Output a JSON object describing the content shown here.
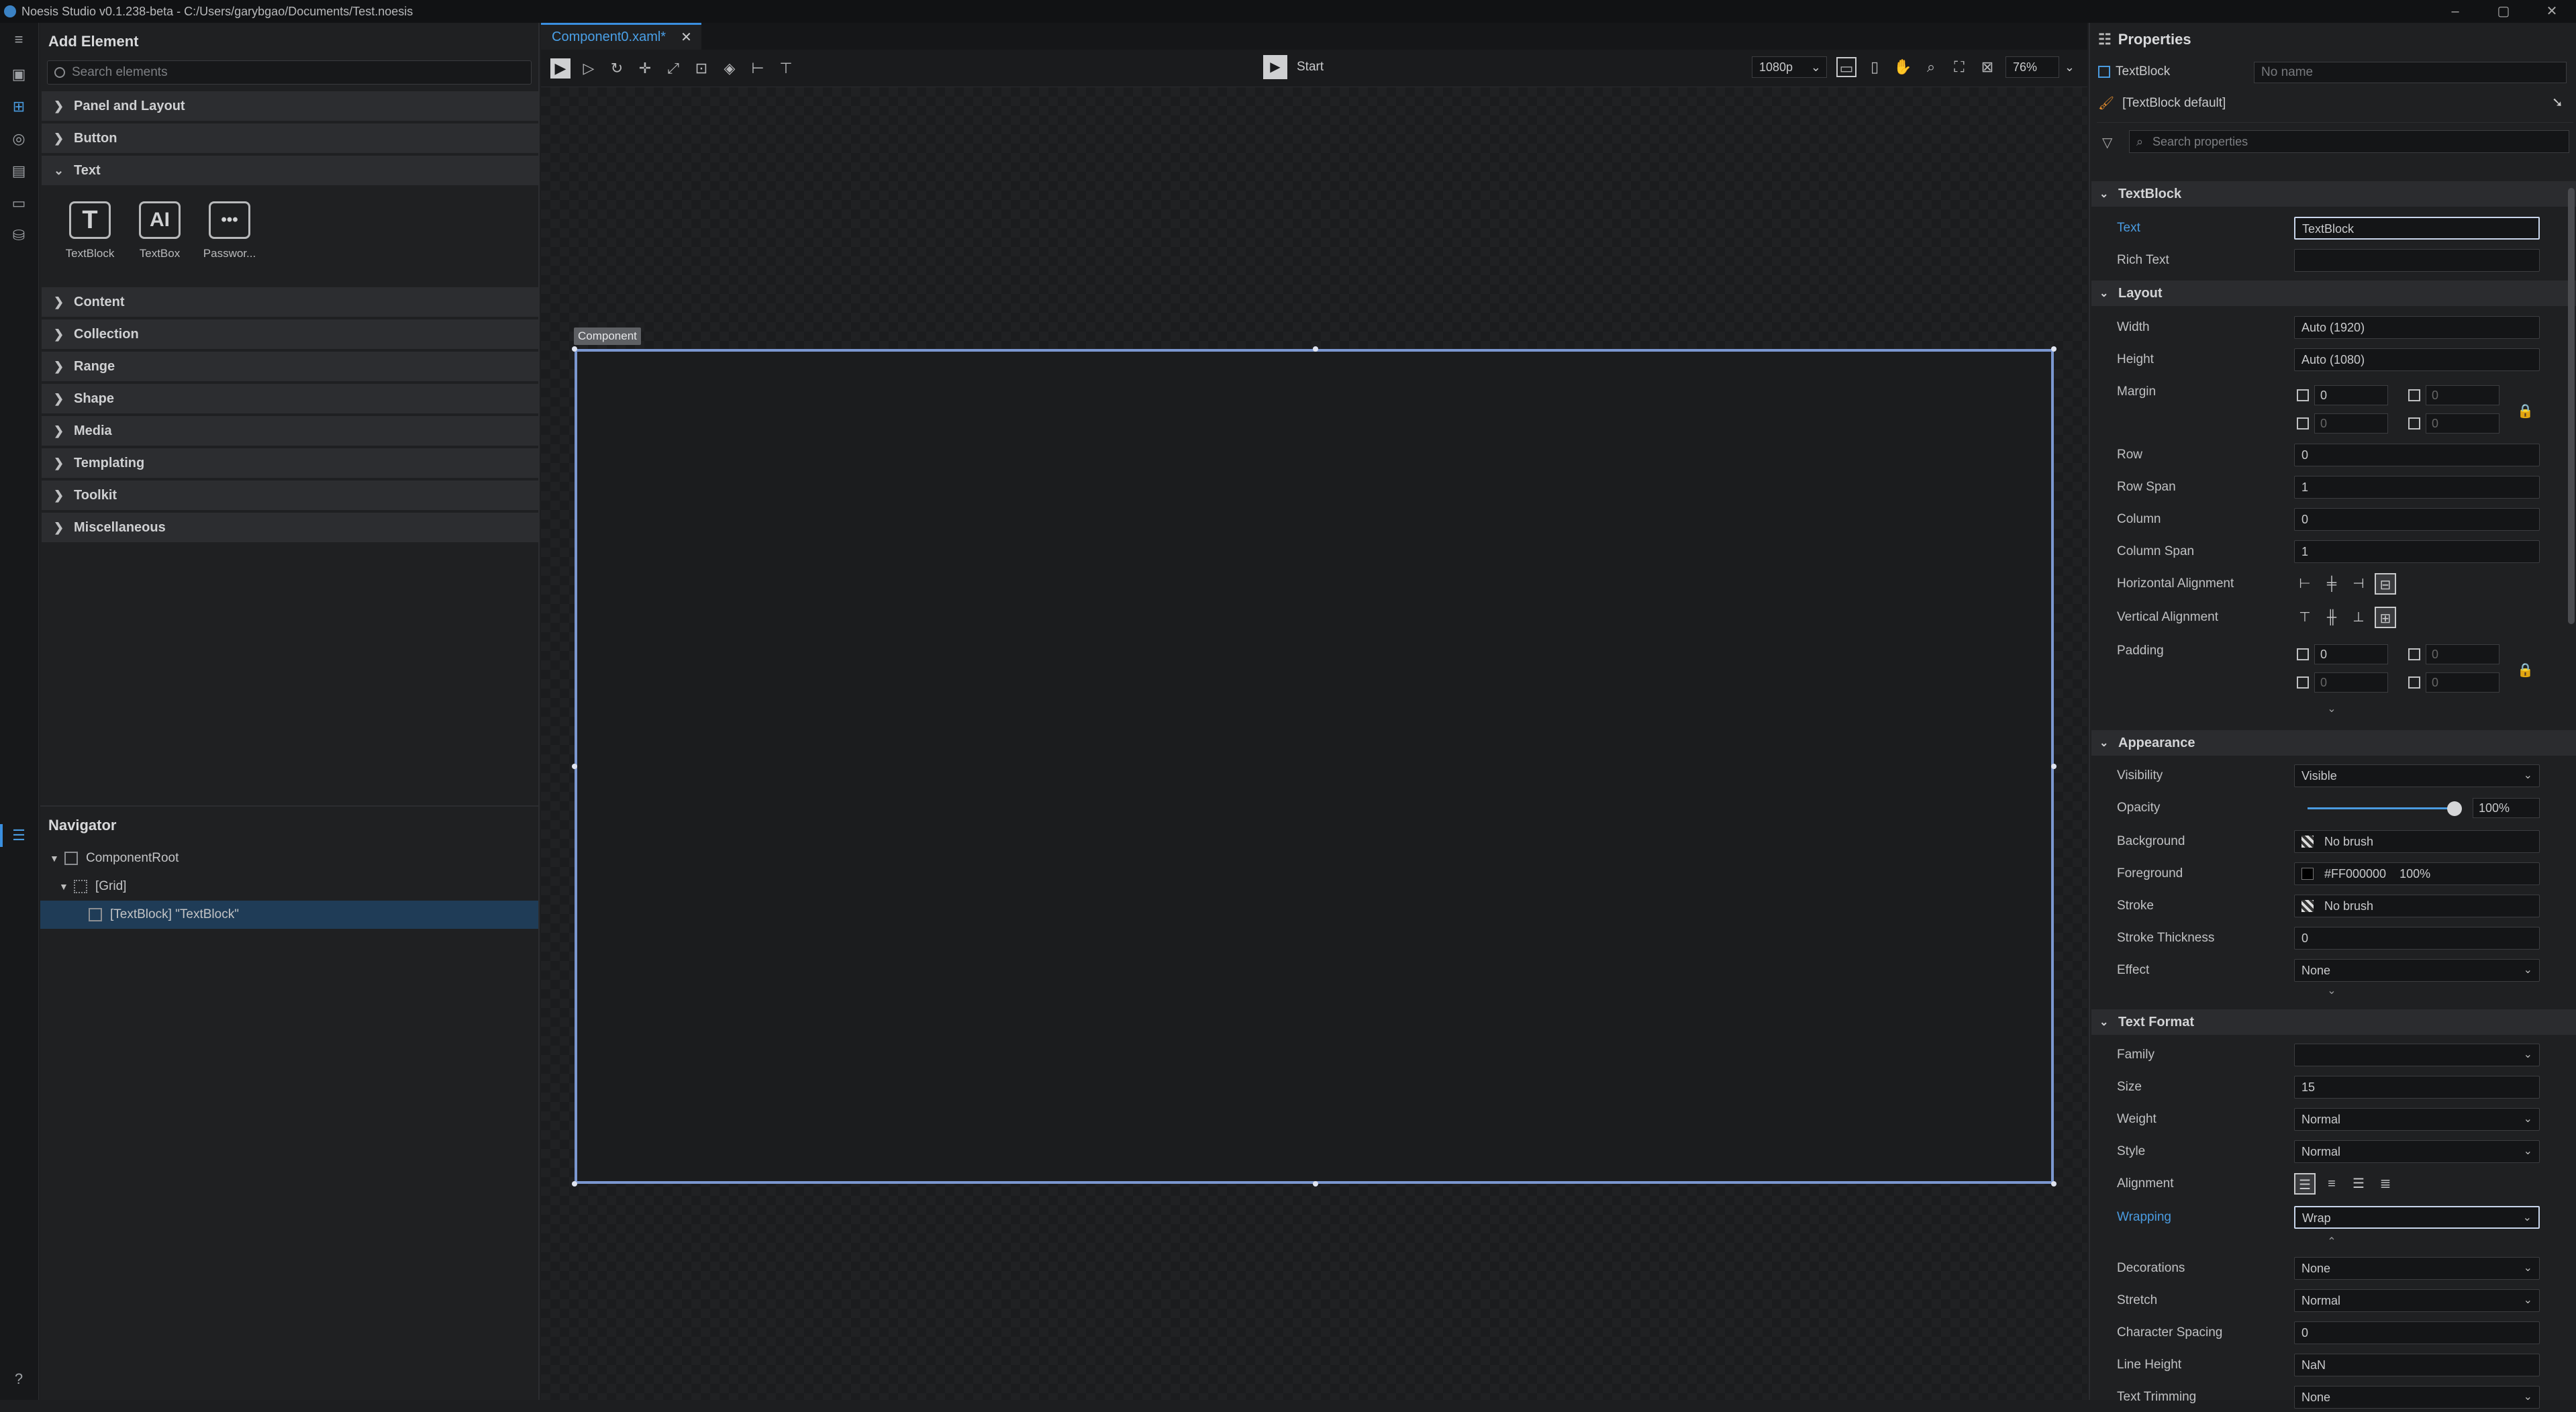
{
  "titlebar": {
    "title": "Noesis Studio v0.1.238-beta - C:/Users/garybgao/Documents/Test.noesis",
    "min": "–",
    "max": "▢",
    "close": "✕"
  },
  "add": {
    "title": "Add Element",
    "search": "Search elements",
    "cats_top": [
      "Panel and Layout",
      "Button",
      "Text"
    ],
    "tiles": [
      {
        "label": "TextBlock",
        "glyph": "T"
      },
      {
        "label": "TextBox",
        "glyph": "AI"
      },
      {
        "label": "Passwor...",
        "glyph": "•••"
      }
    ],
    "cats_bottom": [
      "Content",
      "Collection",
      "Range",
      "Shape",
      "Media",
      "Templating",
      "Toolkit",
      "Miscellaneous"
    ]
  },
  "navigator": {
    "title": "Navigator",
    "items": [
      "ComponentRoot",
      "[Grid]",
      "[TextBlock] \"TextBlock\""
    ]
  },
  "editor": {
    "tab": "Component0.xaml*",
    "start": "Start",
    "resolution": "1080p",
    "zoom": "76%",
    "component_label": "Component"
  },
  "props": {
    "title": "Properties",
    "type": "TextBlock",
    "name_placeholder": "No name",
    "style": "[TextBlock default]",
    "search": "Search properties",
    "sections": {
      "textblock": "TextBlock",
      "layout": "Layout",
      "appearance": "Appearance",
      "textformat": "Text Format"
    },
    "text": {
      "label": "Text",
      "value": "TextBlock"
    },
    "rich": {
      "label": "Rich Text",
      "value": ""
    },
    "width": {
      "label": "Width",
      "value": "Auto (1920)"
    },
    "height": {
      "label": "Height",
      "value": "Auto (1080)"
    },
    "margin": {
      "label": "Margin",
      "v": [
        "0",
        "0",
        "0",
        "0"
      ]
    },
    "row": {
      "label": "Row",
      "value": "0"
    },
    "rowspan": {
      "label": "Row Span",
      "value": "1"
    },
    "column": {
      "label": "Column",
      "value": "0"
    },
    "colspan": {
      "label": "Column Span",
      "value": "1"
    },
    "halign": {
      "label": "Horizontal Alignment"
    },
    "valign": {
      "label": "Vertical Alignment"
    },
    "padding": {
      "label": "Padding",
      "v": [
        "0",
        "0",
        "0",
        "0"
      ]
    },
    "visibility": {
      "label": "Visibility",
      "value": "Visible"
    },
    "opacity": {
      "label": "Opacity",
      "value": "100%",
      "level": 1.0
    },
    "background": {
      "label": "Background",
      "value": "No brush"
    },
    "foreground": {
      "label": "Foreground",
      "value": "#FF000000",
      "pct": "100%"
    },
    "stroke": {
      "label": "Stroke",
      "value": "No brush"
    },
    "strokethick": {
      "label": "Stroke Thickness",
      "value": "0"
    },
    "effect": {
      "label": "Effect",
      "value": "None"
    },
    "family": {
      "label": "Family",
      "value": ""
    },
    "size": {
      "label": "Size",
      "value": "15"
    },
    "weight": {
      "label": "Weight",
      "value": "Normal"
    },
    "style2": {
      "label": "Style",
      "value": "Normal"
    },
    "alignment": {
      "label": "Alignment"
    },
    "wrapping": {
      "label": "Wrapping",
      "value": "Wrap"
    },
    "decorations": {
      "label": "Decorations",
      "value": "None"
    },
    "stretch": {
      "label": "Stretch",
      "value": "Normal"
    },
    "charspacing": {
      "label": "Character Spacing",
      "value": "0"
    },
    "lineheight": {
      "label": "Line Height",
      "value": "NaN"
    },
    "trimming": {
      "label": "Text Trimming",
      "value": "None"
    }
  }
}
